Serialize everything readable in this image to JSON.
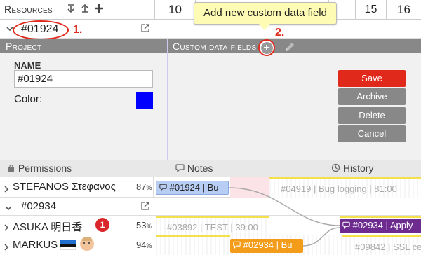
{
  "header": {
    "resources_label": "Resources",
    "day_columns": [
      "10",
      "15",
      "16"
    ]
  },
  "tooltip": {
    "text": "Add new custom data field"
  },
  "annotations": {
    "step1": "1.",
    "step2": "2.",
    "accent_color": "#e0281b"
  },
  "project": {
    "name": "#01924",
    "panel_headers": {
      "project": "Project",
      "custom_data_fields": "Custom data fields"
    },
    "form": {
      "name_label": "NAME",
      "name_value": "#01924",
      "color_label": "Color:",
      "color_value": "#0000ff"
    },
    "buttons": {
      "save": "Save",
      "archive": "Archive",
      "delete": "Delete",
      "cancel": "Cancel"
    },
    "tabs": {
      "permissions": "Permissions",
      "notes": "Notes",
      "history": "History"
    }
  },
  "rows": {
    "stefanos": {
      "name": "STEFANOS Στεφανος",
      "pct": "87",
      "bar1": "#01924 | Bu",
      "ghost": "#04919 | Bug logging | 81:00"
    },
    "group": {
      "name": "#02934"
    },
    "asuka": {
      "name": "ASUKA 明日香",
      "badge": "1",
      "pct": "53",
      "ghost": "#03892 | TEST | 39:00",
      "bar": "#02934 | Apply"
    },
    "markus": {
      "name": "MARKUS",
      "pct": "94",
      "bar": "#02934 | Bu",
      "ghost": "#09842 | SSL ce"
    }
  },
  "pct_suffix": "%",
  "colors": {
    "save": "#e0281b",
    "secondary_button": "#888888",
    "blue_bar": "#b7cdf3",
    "purple_bar": "#6d2b8f",
    "orange_bar": "#f39c1a",
    "pink": "#fbe3e8"
  }
}
